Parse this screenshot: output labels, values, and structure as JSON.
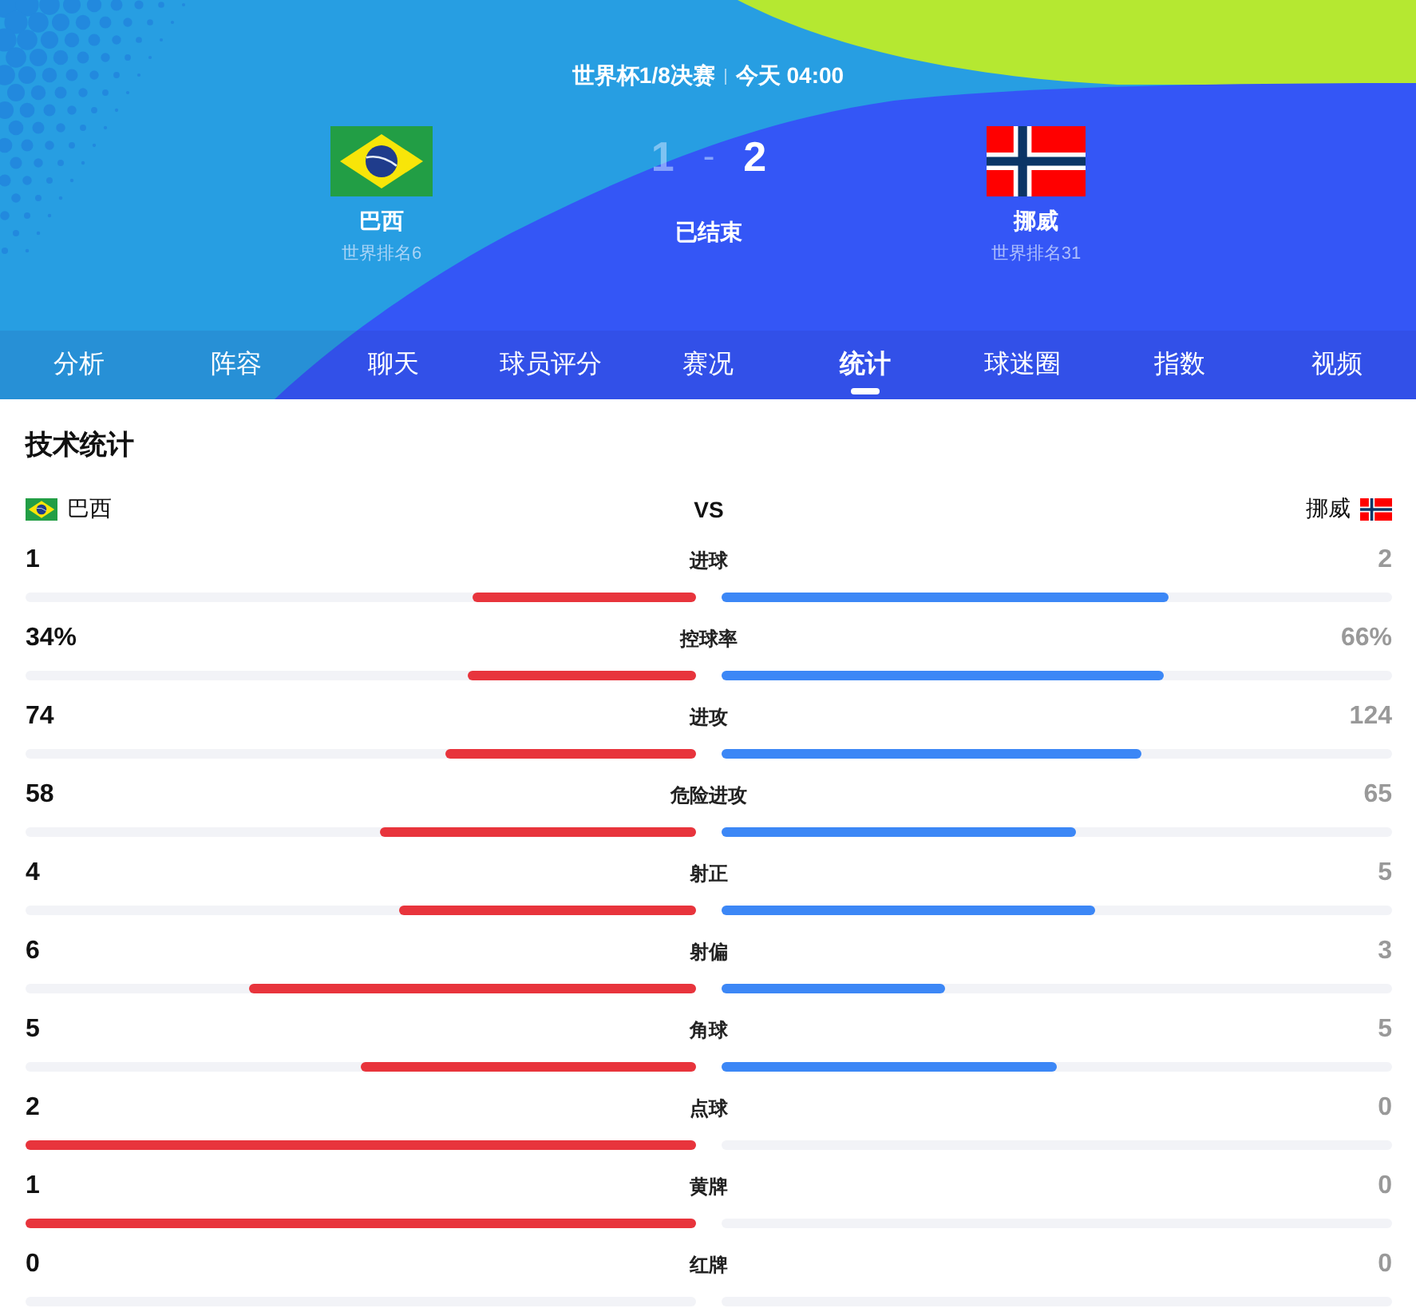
{
  "header": {
    "competition": "世界杯1/8决赛",
    "time": "今天 04:00",
    "home": {
      "name": "巴西",
      "rank": "世界排名6"
    },
    "away": {
      "name": "挪威",
      "rank": "世界排名31"
    },
    "score": {
      "home": {
        "value": "1",
        "winner": false
      },
      "separator": "-",
      "away": {
        "value": "2",
        "winner": true
      }
    },
    "status": "已结束"
  },
  "tabs": [
    {
      "label": "分析",
      "selected": false
    },
    {
      "label": "阵容",
      "selected": false
    },
    {
      "label": "聊天",
      "selected": false
    },
    {
      "label": "球员评分",
      "selected": false
    },
    {
      "label": "赛况",
      "selected": false
    },
    {
      "label": "统计",
      "selected": true
    },
    {
      "label": "球迷圈",
      "selected": false
    },
    {
      "label": "指数",
      "selected": false
    },
    {
      "label": "视频",
      "selected": false
    }
  ],
  "stats_section": {
    "title": "技术统计",
    "home_team": {
      "name": "巴西"
    },
    "vs": "VS",
    "away_team": {
      "name": "挪威"
    },
    "rows": [
      {
        "label": "进球",
        "home": {
          "value": "1",
          "level": 0.333
        },
        "away": {
          "value": "2",
          "level": 0.667
        }
      },
      {
        "label": "控球率",
        "home": {
          "value": "34%",
          "level": 0.34
        },
        "away": {
          "value": "66%",
          "level": 0.66
        }
      },
      {
        "label": "进攻",
        "home": {
          "value": "74",
          "level": 0.374
        },
        "away": {
          "value": "124",
          "level": 0.626
        }
      },
      {
        "label": "危险进攻",
        "home": {
          "value": "58",
          "level": 0.472
        },
        "away": {
          "value": "65",
          "level": 0.528
        }
      },
      {
        "label": "射正",
        "home": {
          "value": "4",
          "level": 0.444
        },
        "away": {
          "value": "5",
          "level": 0.556
        }
      },
      {
        "label": "射偏",
        "home": {
          "value": "6",
          "level": 0.667
        },
        "away": {
          "value": "3",
          "level": 0.333
        }
      },
      {
        "label": "角球",
        "home": {
          "value": "5",
          "level": 0.5
        },
        "away": {
          "value": "5",
          "level": 0.5
        }
      },
      {
        "label": "点球",
        "home": {
          "value": "2",
          "level": 1
        },
        "away": {
          "value": "0",
          "level": 0
        }
      },
      {
        "label": "黄牌",
        "home": {
          "value": "1",
          "level": 1
        },
        "away": {
          "value": "0",
          "level": 0
        }
      },
      {
        "label": "红牌",
        "home": {
          "value": "0",
          "level": 0
        },
        "away": {
          "value": "0",
          "level": 0
        }
      }
    ]
  }
}
